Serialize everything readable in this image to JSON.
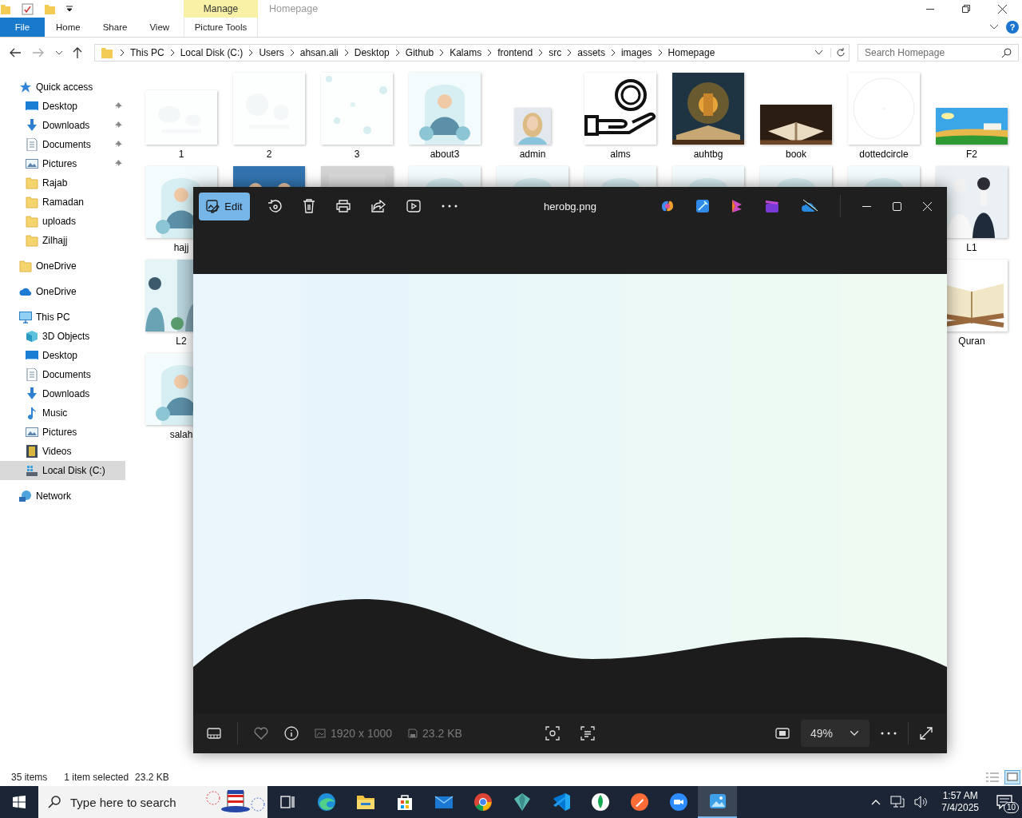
{
  "explorer": {
    "title": "Homepage",
    "context_label": "Manage",
    "help": "?",
    "tabs": [
      {
        "label": "File",
        "kind": "file"
      },
      {
        "label": "Home",
        "kind": "plain"
      },
      {
        "label": "Share",
        "kind": "plain"
      },
      {
        "label": "View",
        "kind": "plain"
      },
      {
        "label": "Picture Tools",
        "kind": "context"
      }
    ],
    "breadcrumb": [
      "This PC",
      "Local Disk (C:)",
      "Users",
      "ahsan.ali",
      "Desktop",
      "Github",
      "Kalams",
      "frontend",
      "src",
      "assets",
      "images",
      "Homepage"
    ],
    "search": {
      "placeholder": "Search Homepage"
    },
    "sidebar": {
      "items": [
        {
          "label": "Quick access",
          "kind": "star",
          "selected": false,
          "children": [
            {
              "label": "Desktop",
              "kind": "desktop",
              "pinned": true,
              "selected": false
            },
            {
              "label": "Downloads",
              "kind": "download",
              "pinned": true,
              "selected": false
            },
            {
              "label": "Documents",
              "kind": "document",
              "pinned": true,
              "selected": false
            },
            {
              "label": "Pictures",
              "kind": "pictures",
              "pinned": true,
              "selected": false
            },
            {
              "label": "Rajab",
              "kind": "folder",
              "pinned": false,
              "selected": false
            },
            {
              "label": "Ramadan",
              "kind": "folder",
              "pinned": false,
              "selected": false
            },
            {
              "label": "uploads",
              "kind": "folder",
              "pinned": false,
              "selected": false
            },
            {
              "label": "Zilhajj",
              "kind": "folder",
              "pinned": false,
              "selected": false
            }
          ]
        },
        {
          "label": "OneDrive",
          "kind": "folder",
          "selected": false
        },
        {
          "label": "OneDrive",
          "kind": "cloud",
          "selected": false
        },
        {
          "label": "This PC",
          "kind": "pc",
          "selected": false,
          "children": [
            {
              "label": "3D Objects",
              "kind": "cube",
              "pinned": false,
              "selected": false
            },
            {
              "label": "Desktop",
              "kind": "desktop",
              "pinned": false,
              "selected": false
            },
            {
              "label": "Documents",
              "kind": "document",
              "pinned": false,
              "selected": false
            },
            {
              "label": "Downloads",
              "kind": "download",
              "pinned": false,
              "selected": false
            },
            {
              "label": "Music",
              "kind": "music",
              "pinned": false,
              "selected": false
            },
            {
              "label": "Pictures",
              "kind": "pictures",
              "pinned": false,
              "selected": false
            },
            {
              "label": "Videos",
              "kind": "video",
              "pinned": false,
              "selected": false
            },
            {
              "label": "Local Disk (C:)",
              "kind": "disk",
              "pinned": false,
              "selected": true
            }
          ]
        },
        {
          "label": "Network",
          "kind": "network",
          "selected": false
        }
      ]
    },
    "files": {
      "rows": [
        [
          {
            "kind": "file",
            "name": "1"
          },
          {
            "kind": "file",
            "name": "2"
          },
          {
            "kind": "file",
            "name": "3"
          },
          {
            "kind": "file",
            "name": "about3"
          },
          {
            "kind": "file",
            "name": "admin"
          },
          {
            "kind": "file",
            "name": "alms"
          },
          {
            "kind": "file",
            "name": "auhtbg"
          },
          {
            "kind": "file",
            "name": "book"
          },
          {
            "kind": "file",
            "name": "dottedcircle"
          },
          {
            "kind": "file",
            "name": "F2"
          }
        ],
        [
          {
            "kind": "file",
            "name": "hajj"
          },
          {
            "kind": "picture"
          },
          {
            "kind": "picture"
          },
          {
            "kind": "picture"
          },
          {
            "kind": "picture"
          },
          {
            "kind": "picture"
          },
          {
            "kind": "picture"
          },
          {
            "kind": "picture"
          },
          {
            "kind": "picture"
          },
          {
            "kind": "file",
            "name": "L1"
          }
        ],
        [
          {
            "kind": "file",
            "name": "L2"
          },
          "",
          "",
          "",
          "",
          "",
          "",
          "",
          "",
          {
            "kind": "file",
            "name": "Quran"
          }
        ],
        [
          {
            "kind": "file",
            "name": "salah"
          }
        ]
      ]
    },
    "status_bar": {
      "count": "35 items",
      "selection": "1 item selected",
      "size": "23.2 KB"
    }
  },
  "viewer": {
    "title": "herobg.png",
    "edit_label": "Edit",
    "dimensions": "1920 x 1000",
    "file_size": "23.2 KB",
    "zoom": "49%"
  },
  "taskbar": {
    "search_placeholder": "Type here to search",
    "apps": [
      {
        "kind": "task-view",
        "selected": false
      },
      {
        "kind": "browser",
        "selected": false
      },
      {
        "kind": "explorer",
        "selected": false
      },
      {
        "kind": "store",
        "selected": false
      },
      {
        "kind": "mail",
        "selected": false
      },
      {
        "kind": "chrome",
        "selected": false
      },
      {
        "kind": "diamond",
        "selected": false
      },
      {
        "kind": "code",
        "selected": false
      },
      {
        "kind": "leaf",
        "selected": false
      },
      {
        "kind": "rocket",
        "selected": false
      },
      {
        "kind": "camera",
        "selected": false
      },
      {
        "kind": "photos",
        "selected": true
      }
    ],
    "time": "1:57 AM",
    "date": "7/4/2025",
    "notifications": "10"
  }
}
